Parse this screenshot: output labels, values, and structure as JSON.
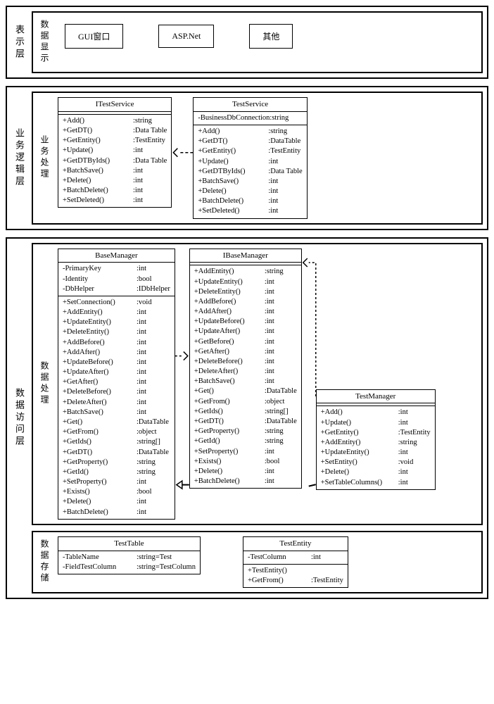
{
  "layers": {
    "presentation": {
      "label": "表示层",
      "sub_label": "数据显示",
      "boxes": [
        "GUI窗口",
        "ASP.Net",
        "其他"
      ]
    },
    "business": {
      "label": "业务逻辑层",
      "sub_label": "业务处理"
    },
    "data_access": {
      "label": "数据访问层",
      "sub_proc": "数据处理",
      "sub_store": "数据存储"
    }
  },
  "classes": {
    "ITestService": {
      "title": "ITestService",
      "attrs": [],
      "ops": [
        [
          "+Add()",
          ":string"
        ],
        [
          "+GetDT()",
          ":Data Table"
        ],
        [
          "+GetEntity()",
          ":TestEntity"
        ],
        [
          "+Update()",
          ":int"
        ],
        [
          "+GetDTByIds()",
          ":Data Table"
        ],
        [
          "+BatchSave()",
          ":int"
        ],
        [
          "+Delete()",
          ":int"
        ],
        [
          "+BatchDelete()",
          ":int"
        ],
        [
          "+SetDeleted()",
          ":int"
        ]
      ]
    },
    "TestService": {
      "title": "TestService",
      "attrs": [
        [
          "-BusinessDbConnection",
          ":string"
        ]
      ],
      "ops": [
        [
          "+Add()",
          ":string"
        ],
        [
          "+GetDT()",
          ":DataTable"
        ],
        [
          "+GetEntity()",
          ":TestEntity"
        ],
        [
          "+Update()",
          ":int"
        ],
        [
          "+GetDTByIds()",
          ":Data Table"
        ],
        [
          "+BatchSave()",
          ":int"
        ],
        [
          "+Delete()",
          ":int"
        ],
        [
          "+BatchDelete()",
          ":int"
        ],
        [
          "+SetDeleted()",
          ":int"
        ]
      ]
    },
    "BaseManager": {
      "title": "BaseManager",
      "attrs": [
        [
          "-PrimaryKey",
          ":int"
        ],
        [
          "-Identity",
          ":bool"
        ],
        [
          "-DbHelper",
          ":IDbHelper"
        ]
      ],
      "ops": [
        [
          "+SetConnection()",
          ":void"
        ],
        [
          "+AddEntity()",
          ":int"
        ],
        [
          "+UpdateEntity()",
          ":int"
        ],
        [
          "+DeleteEntity()",
          ":int"
        ],
        [
          "+AddBefore()",
          ":int"
        ],
        [
          "+AddAfter()",
          ":int"
        ],
        [
          "+UpdateBefore()",
          ":int"
        ],
        [
          "+UpdateAfter()",
          ":int"
        ],
        [
          "+GetAfter()",
          ":int"
        ],
        [
          "+DeleteBefore()",
          ":int"
        ],
        [
          "+DeleteAfter()",
          ":int"
        ],
        [
          "+BatchSave()",
          ":int"
        ],
        [
          "+Get()",
          ":DataTable"
        ],
        [
          "+GetFrom()",
          ":object"
        ],
        [
          "+GetIds()",
          ":string[]"
        ],
        [
          "+GetDT()",
          ":DataTable"
        ],
        [
          "+GetProperty()",
          ":string"
        ],
        [
          "+GetId()",
          ":string"
        ],
        [
          "+SetProperty()",
          ":int"
        ],
        [
          "+Exists()",
          ":bool"
        ],
        [
          "+Delete()",
          ":int"
        ],
        [
          "+BatchDelete()",
          ":int"
        ]
      ]
    },
    "IBaseManager": {
      "title": "IBaseManager",
      "attrs": [],
      "ops": [
        [
          "+AddEntity()",
          ":string"
        ],
        [
          "+UpdateEntity()",
          ":int"
        ],
        [
          "+DeleteEntity()",
          ":int"
        ],
        [
          "+AddBefore()",
          ":int"
        ],
        [
          "+AddAfter()",
          ":int"
        ],
        [
          "+UpdateBefore()",
          ":int"
        ],
        [
          "+UpdateAfter()",
          ":int"
        ],
        [
          "+GetBefore()",
          ":int"
        ],
        [
          "+GetAfter()",
          ":int"
        ],
        [
          "+DeleteBefore()",
          ":int"
        ],
        [
          "+DeleteAfter()",
          ":int"
        ],
        [
          "+BatchSave()",
          ":int"
        ],
        [
          "+Get()",
          ":DataTable"
        ],
        [
          "+GetFrom()",
          ":object"
        ],
        [
          "+GetIds()",
          ":string[]"
        ],
        [
          "+GetDT()",
          ":DataTable"
        ],
        [
          "+GetProperty()",
          ":string"
        ],
        [
          "+GetId()",
          ":string"
        ],
        [
          "+SetProperty()",
          ":int"
        ],
        [
          "+Exists()",
          ":bool"
        ],
        [
          "+Delete()",
          ":int"
        ],
        [
          "+BatchDelete()",
          ":int"
        ]
      ]
    },
    "TestManager": {
      "title": "TestManager",
      "attrs": [],
      "ops": [
        [
          "+Add()",
          ":int"
        ],
        [
          "+Update()",
          ":int"
        ],
        [
          "+GetEntity()",
          ":TestEntity"
        ],
        [
          "+AddEntity()",
          ":string"
        ],
        [
          "+UpdateEntity()",
          ":int"
        ],
        [
          "+SetEntity()",
          ":void"
        ],
        [
          "+Delete()",
          ":int"
        ],
        [
          "+SetTableColumns()",
          ":int"
        ]
      ]
    },
    "TestTable": {
      "title": "TestTable",
      "attrs": [
        [
          "-TableName",
          ":string=Test"
        ],
        [
          "-FieldTestColumn",
          ":string=TestColumn"
        ]
      ],
      "ops": []
    },
    "TestEntity": {
      "title": "TestEntity",
      "attrs": [
        [
          "-TestColumn",
          ":int"
        ]
      ],
      "ops": [
        [
          "+TestEntity()",
          ""
        ],
        [
          "+GetFrom()",
          ":TestEntity"
        ]
      ]
    }
  }
}
